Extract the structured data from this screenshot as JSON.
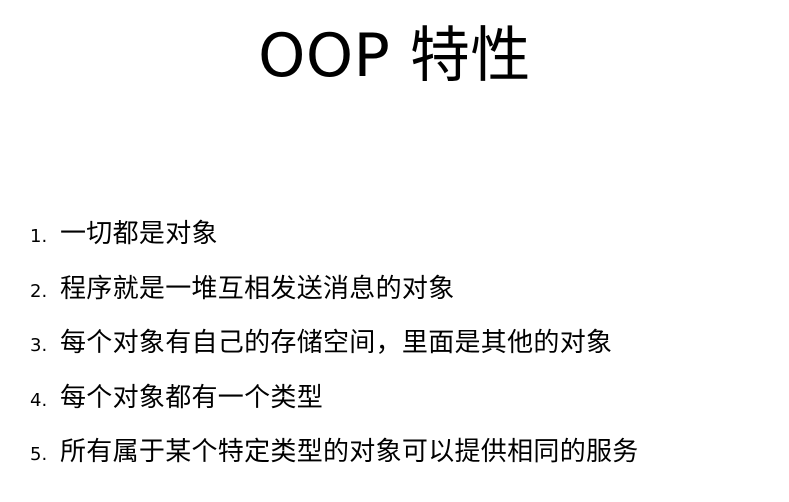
{
  "slide": {
    "title": "OOP 特性",
    "items": [
      {
        "num": "1.",
        "text": "一切都是对象"
      },
      {
        "num": "2.",
        "text": "程序就是一堆互相发送消息的对象"
      },
      {
        "num": "3.",
        "text": "每个对象有自己的存储空间，里面是其他的对象"
      },
      {
        "num": "4.",
        "text": "每个对象都有一个类型"
      },
      {
        "num": "5.",
        "text": "所有属于某个特定类型的对象可以提供相同的服务"
      }
    ]
  }
}
